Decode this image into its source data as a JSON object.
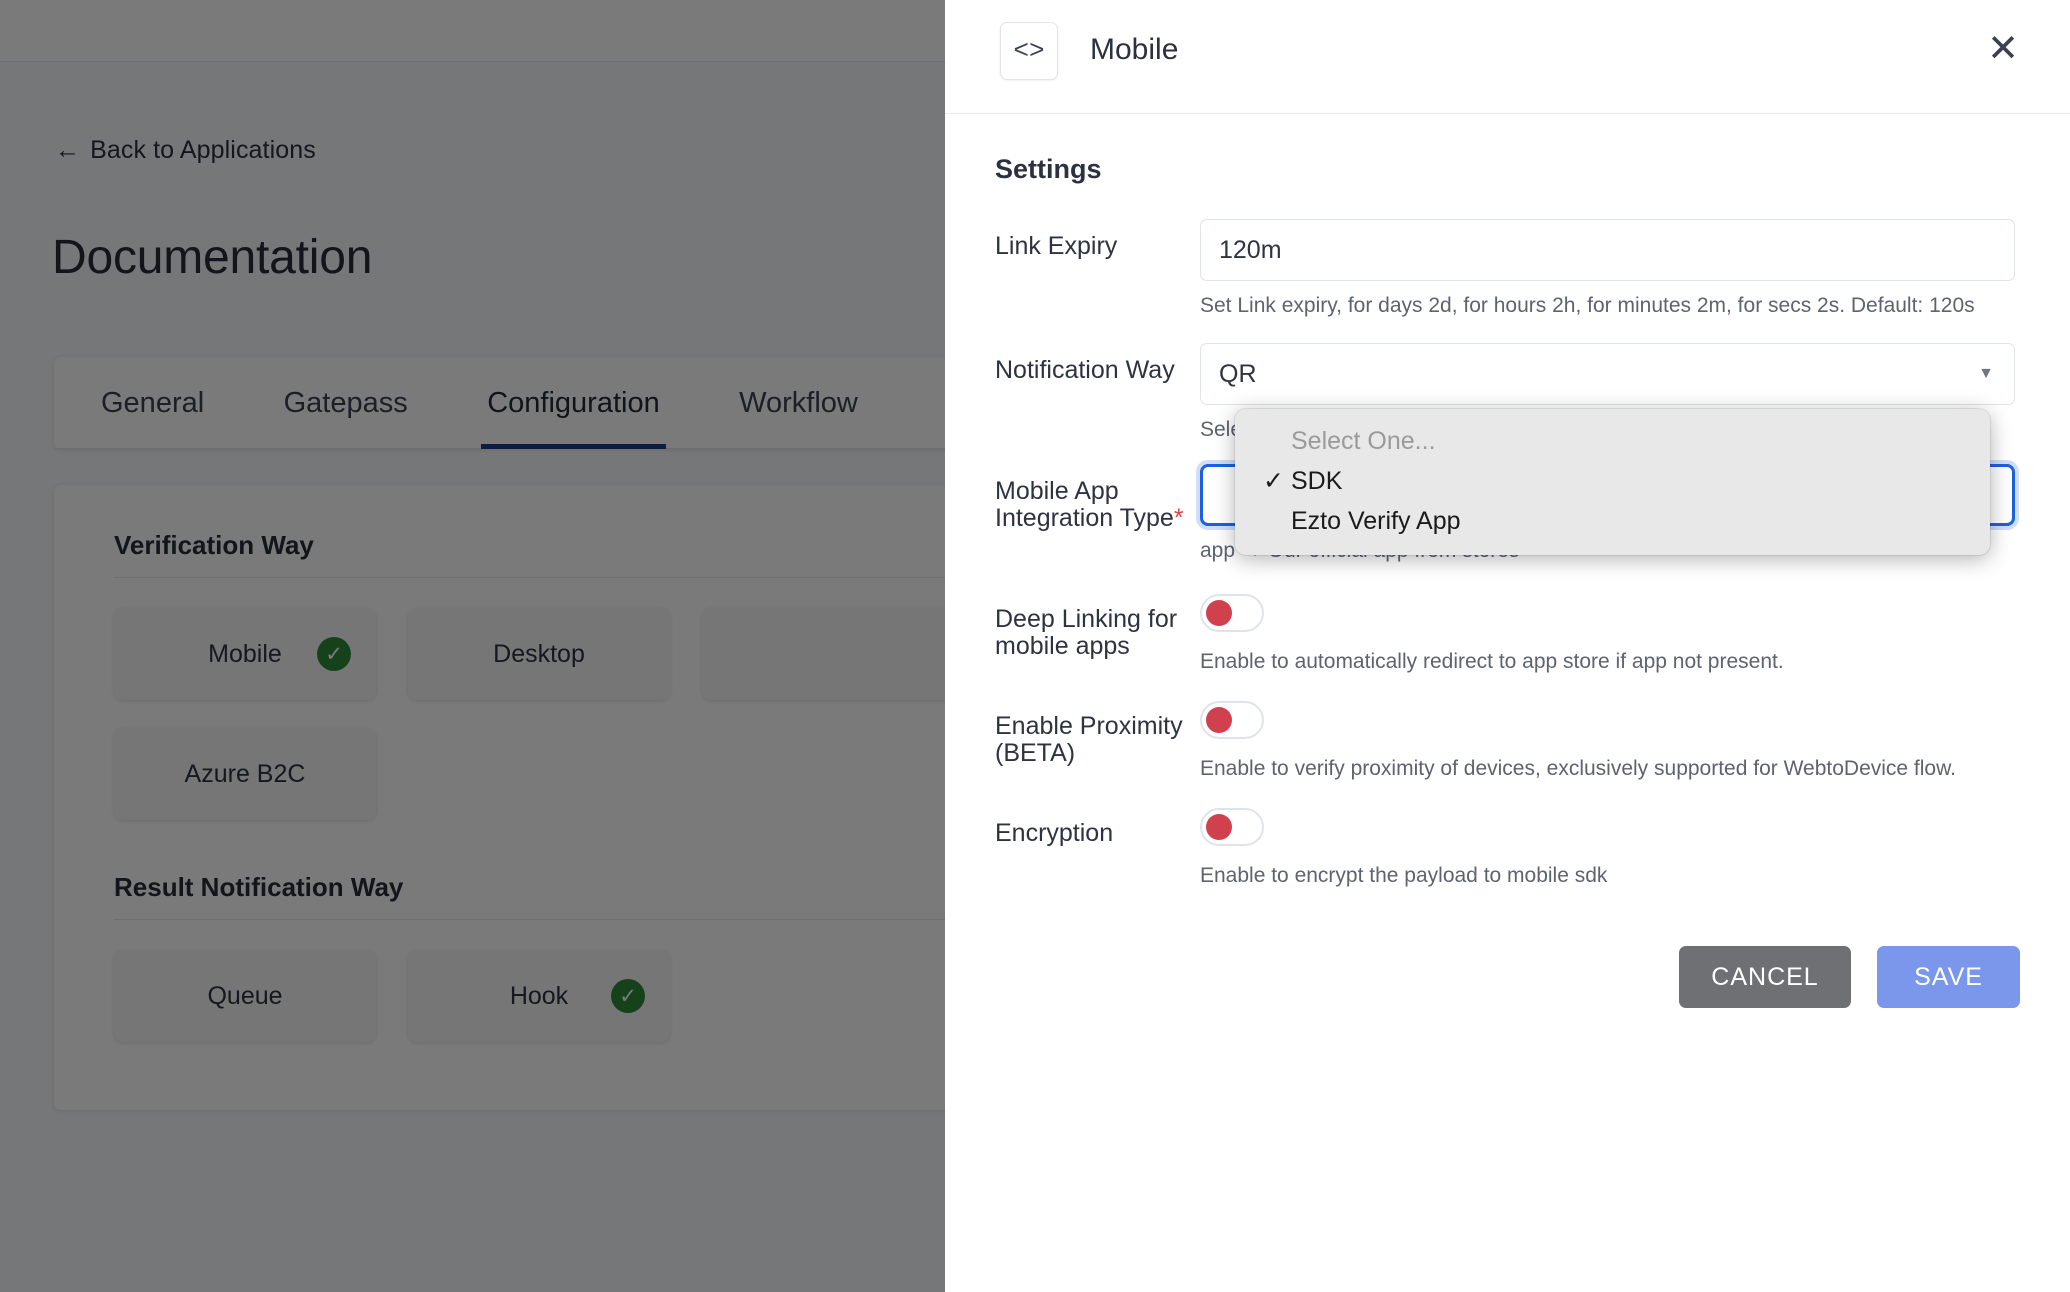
{
  "background": {
    "back_link": {
      "icon": "arrow-left-icon",
      "arrow": "←",
      "label": "Back to Applications"
    },
    "page_title": "Documentation",
    "tabs": [
      {
        "label": "General",
        "active": false
      },
      {
        "label": "Gatepass",
        "active": false
      },
      {
        "label": "Configuration",
        "active": true
      },
      {
        "label": "Workflow",
        "active": false
      }
    ],
    "sections": [
      {
        "title": "Verification Way",
        "rows": [
          [
            {
              "label": "Mobile",
              "selected": true,
              "check": "✓"
            },
            {
              "label": "Desktop",
              "selected": false,
              "check": ""
            },
            {
              "label": "",
              "selected": false,
              "check": ""
            }
          ],
          [
            {
              "label": "Azure B2C",
              "selected": false,
              "check": ""
            }
          ]
        ]
      },
      {
        "title": "Result Notification Way",
        "rows": [
          [
            {
              "label": "Queue",
              "selected": false,
              "check": ""
            },
            {
              "label": "Hook",
              "selected": true,
              "check": "✓"
            }
          ]
        ]
      }
    ],
    "active_tab_color": "#1e3a8a",
    "check_color": "#2f8a3a"
  },
  "panel": {
    "header": {
      "code_icon": "code-brackets-icon",
      "code_glyph": "<>",
      "title": "Mobile",
      "close_icon": "close-icon",
      "close_glyph": "✕"
    },
    "settings_heading": "Settings",
    "fields": {
      "link_expiry": {
        "label": "Link Expiry",
        "value": "120m",
        "placeholder": "Link Expiry",
        "hint": "Set Link expiry, for days 2d, for hours 2h, for minutes 2m, for secs 2s. Default: 120s"
      },
      "notification_way": {
        "label": "Notification Way",
        "value": "QR",
        "caret": "▼",
        "hint": "Select the notification way thats already implemented in your mobile app"
      },
      "integration_type": {
        "label": "Mobile App",
        "label_line2": "Integration Type",
        "required_mark": "*",
        "hint": "app → Our official app from stores",
        "focused": true,
        "focus_color": "#1b62e0"
      }
    },
    "toggles": [
      {
        "label": "Deep Linking for",
        "label_line2": "mobile apps",
        "on": false,
        "hint": "Enable to automatically redirect to app store if app not present."
      },
      {
        "label": "Enable Proximity",
        "label_line2": "(BETA)",
        "on": false,
        "hint": "Enable to verify proximity of devices, exclusively supported for WebtoDevice flow."
      },
      {
        "label": "Encryption",
        "label_line2": "",
        "on": false,
        "hint": "Enable to encrypt the payload to mobile sdk"
      }
    ],
    "toggle_knob_color": "#d0414d",
    "footer": {
      "cancel_label": "CANCEL",
      "save_label": "SAVE",
      "cancel_color": "#6f7073",
      "save_color": "#7b97eb"
    }
  },
  "dropdown": {
    "open": true,
    "options": [
      {
        "label": "Select One...",
        "placeholder": true,
        "checked": false,
        "tick": ""
      },
      {
        "label": "SDK",
        "placeholder": false,
        "checked": true,
        "tick": "✓"
      },
      {
        "label": "Ezto Verify App",
        "placeholder": false,
        "checked": false,
        "tick": ""
      }
    ]
  }
}
